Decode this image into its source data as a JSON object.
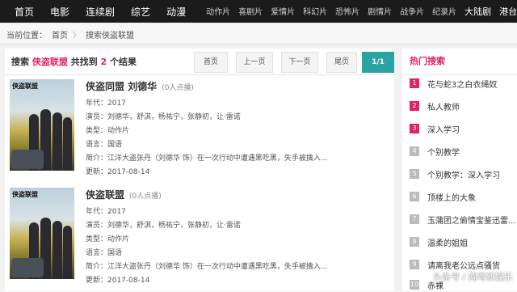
{
  "nav": {
    "main": [
      "首页",
      "电影",
      "连续剧",
      "综艺",
      "动漫"
    ],
    "sub": [
      "动作片",
      "喜剧片",
      "爱情片",
      "科幻片",
      "恐怖片",
      "剧情片",
      "战争片",
      "纪录片"
    ],
    "sub_big": [
      "大陆剧",
      "港台剧"
    ]
  },
  "breadcrumb": {
    "label": "当前位置：",
    "home": "首页",
    "sep": "〉",
    "current": "搜索侠盗联盟"
  },
  "results": {
    "prefix": "搜索 ",
    "keyword": "侠盗联盟",
    "mid": " 共找到 ",
    "count": "2",
    "suffix": " 个结果"
  },
  "pager": {
    "first": "首页",
    "prev": "上一页",
    "next": "下一页",
    "last": "尾页",
    "current": "1/1"
  },
  "items": [
    {
      "title": "侠盗同盟 刘德华",
      "votes": "(0人点播)",
      "poster_text": "侠盗联盟",
      "year": "年代：2017",
      "cast": "演员：刘德华，舒淇，杨祐宁，张静初，让·雷诺",
      "genre": "类型：动作片",
      "lang": "语言：国语",
      "desc": "简介：江洋大盗张丹（刘德华 饰）在一次行动中遭遇黑吃黑，失手被擒入...",
      "updated": "更新：2017-08-14"
    },
    {
      "title": "侠盗联盟",
      "votes": "(0人点播)",
      "poster_text": "侠盗联盟",
      "year": "年代：2017",
      "cast": "演员：刘德华，舒淇，杨祐宁，张静初，让·雷诺",
      "genre": "类型：动作片",
      "lang": "语言：国语",
      "desc": "简介：江洋大盗张丹（刘德华 饰）在一次行动中遭遇黑吃黑，失手被擒入...",
      "updated": "更新：2017-08-14"
    }
  ],
  "hot": {
    "title": "热门搜索",
    "items": [
      {
        "n": "1",
        "t": "花与蛇3之白衣绳奴"
      },
      {
        "n": "2",
        "t": "私人教师"
      },
      {
        "n": "3",
        "t": "深入学习"
      },
      {
        "n": "4",
        "t": "个别教学"
      },
      {
        "n": "5",
        "t": "个别教学：深入学习"
      },
      {
        "n": "6",
        "t": "顶楼上的大象"
      },
      {
        "n": "7",
        "t": "玉蒲团之偷情宝鉴迅雷..."
      },
      {
        "n": "8",
        "t": "温柔的姐姐"
      },
      {
        "n": "9",
        "t": "请离我老公远点骚货"
      },
      {
        "n": "10",
        "t": "赤裸"
      }
    ]
  },
  "watermark": "头条号 / 闯粤新娱乐",
  "colors": {
    "accent": "#e0245e",
    "pager_active": "#2aa3a3",
    "nav_bg": "#1b1b1b"
  }
}
